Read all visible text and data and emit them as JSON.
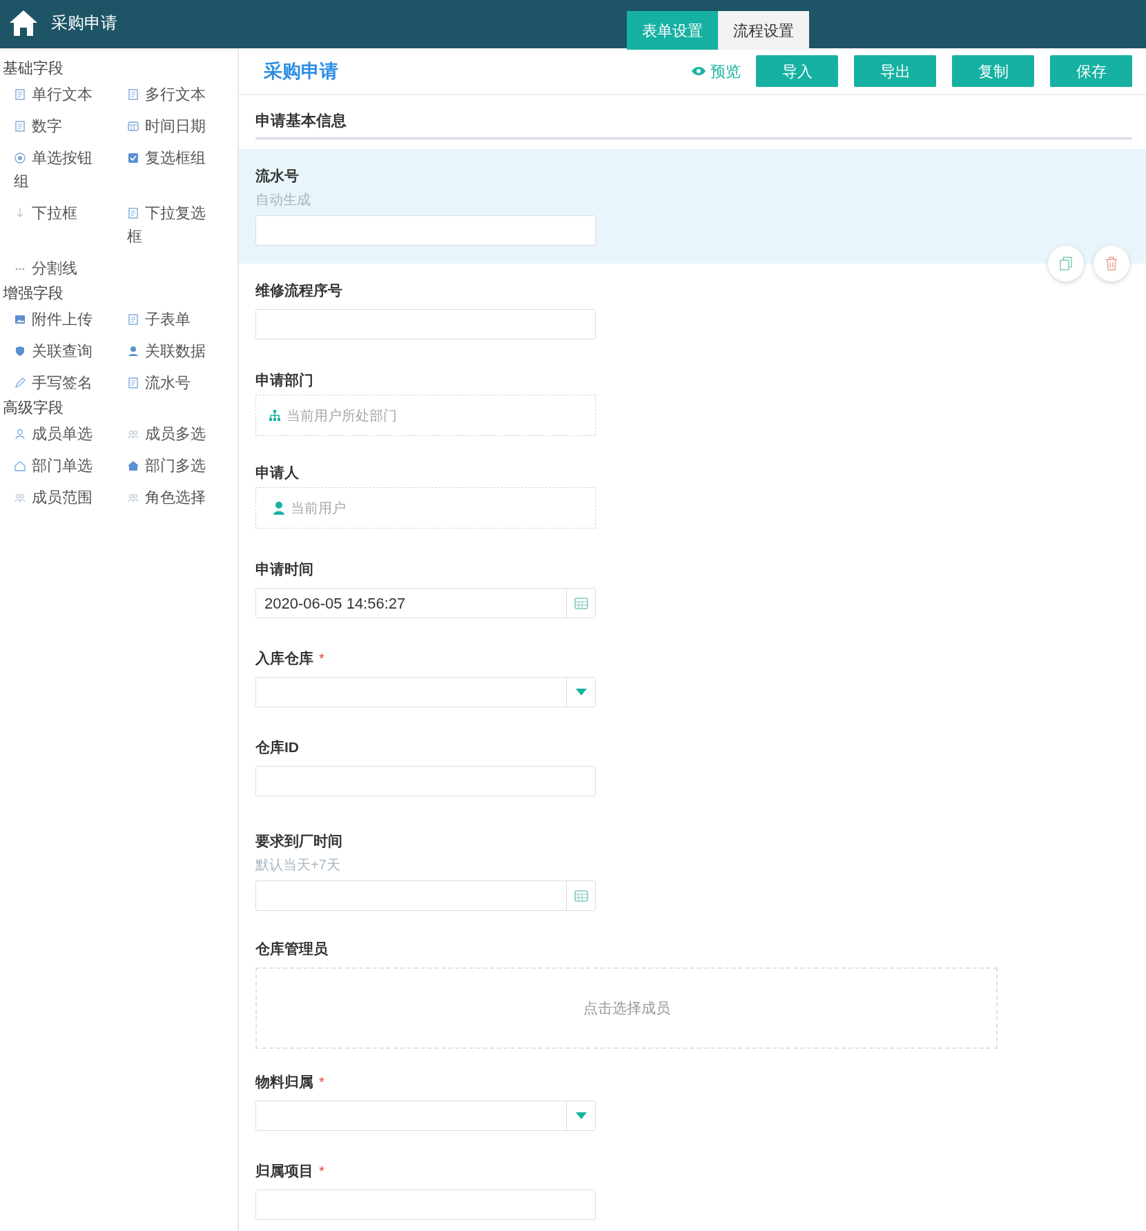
{
  "header": {
    "title": "采购申请",
    "tabs": [
      {
        "label": "表单设置",
        "selected": true
      },
      {
        "label": "流程设置",
        "selected": false
      }
    ]
  },
  "sidebar": {
    "sections": [
      {
        "title": "基础字段",
        "items": [
          {
            "label": "单行文本"
          },
          {
            "label": "多行文本"
          },
          {
            "label": "数字"
          },
          {
            "label": "时间日期"
          },
          {
            "label": "单选按钮组"
          },
          {
            "label": "复选框组"
          },
          {
            "label": "下拉框"
          },
          {
            "label": "下拉复选框"
          },
          {
            "label": "分割线"
          }
        ]
      },
      {
        "title": "增强字段",
        "items": [
          {
            "label": "附件上传"
          },
          {
            "label": "子表单"
          },
          {
            "label": "关联查询"
          },
          {
            "label": "关联数据"
          },
          {
            "label": "手写签名"
          },
          {
            "label": "流水号"
          }
        ]
      },
      {
        "title": "高级字段",
        "items": [
          {
            "label": "成员单选"
          },
          {
            "label": "成员多选"
          },
          {
            "label": "部门单选"
          },
          {
            "label": "部门多选"
          },
          {
            "label": "成员范围"
          },
          {
            "label": "角色选择"
          }
        ]
      }
    ]
  },
  "form": {
    "title": "采购申请",
    "preview": "预览",
    "buttons": [
      "导入",
      "导出",
      "复制",
      "保存"
    ],
    "section": "申请基本信息",
    "fields": [
      {
        "kind": "text",
        "label": "流水号",
        "hint": "自动生成",
        "selected": true
      },
      {
        "kind": "text",
        "label": "维修流程序号",
        "selected": false
      },
      {
        "kind": "dept",
        "label": "申请部门",
        "placeholder": "当前用户所处部门",
        "selected": false
      },
      {
        "kind": "user",
        "label": "申请人",
        "placeholder": "当前用户",
        "selected": false
      },
      {
        "kind": "datetime",
        "label": "申请时间",
        "value": "2020-06-05 14:56:27",
        "selected": false
      },
      {
        "kind": "select",
        "label": "入库仓库",
        "required_mark": "*",
        "selected": false
      },
      {
        "kind": "text",
        "label": "仓库ID",
        "selected": false
      },
      {
        "kind": "datetime",
        "label": "要求到厂时间",
        "hint": "默认当天+7天",
        "selected": false
      },
      {
        "kind": "members",
        "label": "仓库管理员",
        "placeholder": "点击选择成员",
        "selected": false
      },
      {
        "kind": "select",
        "label": "物料归属",
        "required_mark": "*",
        "selected": false
      },
      {
        "kind": "text",
        "label": "归属项目",
        "required_mark": "*",
        "selected": false
      }
    ]
  }
}
